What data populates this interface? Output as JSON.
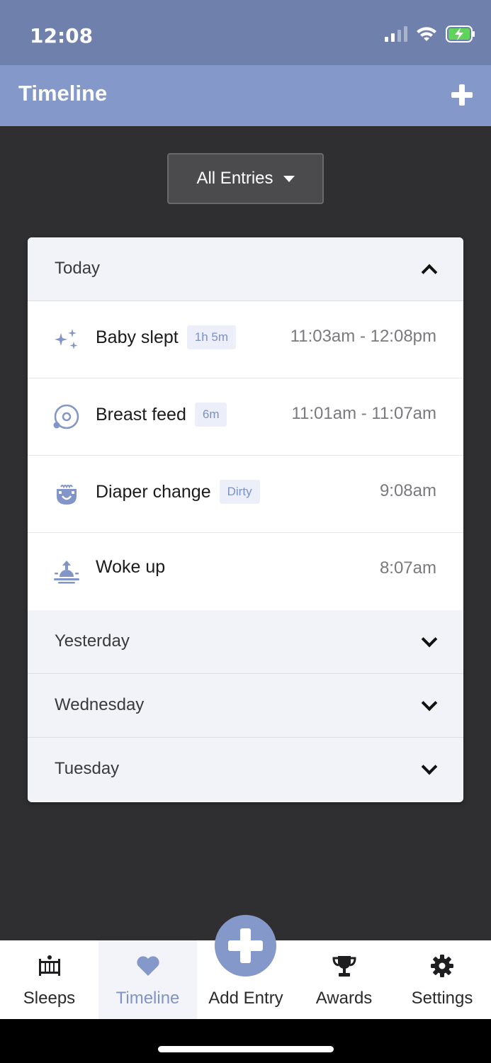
{
  "status": {
    "time": "12:08"
  },
  "header": {
    "title": "Timeline",
    "add_icon": "plus-icon"
  },
  "filter": {
    "label": "All Entries"
  },
  "sections": [
    {
      "label": "Today",
      "expanded": true
    },
    {
      "label": "Yesterday",
      "expanded": false
    },
    {
      "label": "Wednesday",
      "expanded": false
    },
    {
      "label": "Tuesday",
      "expanded": false
    }
  ],
  "entries": [
    {
      "icon": "sparkles-icon",
      "name": "Baby slept",
      "tag": "1h 5m",
      "time": "11:03am - 12:08pm"
    },
    {
      "icon": "breast-feed-icon",
      "name": "Breast feed",
      "tag": "6m",
      "time": "11:01am - 11:07am"
    },
    {
      "icon": "diaper-icon",
      "name": "Diaper change",
      "tag": "Dirty",
      "time": "9:08am"
    },
    {
      "icon": "sunrise-icon",
      "name": "Woke up",
      "tag": "",
      "time": "8:07am"
    }
  ],
  "tabs": [
    {
      "label": "Sleeps",
      "icon": "crib-icon"
    },
    {
      "label": "Timeline",
      "icon": "heart-icon",
      "active": true
    },
    {
      "label": "Add Entry",
      "icon": "plus-icon"
    },
    {
      "label": "Awards",
      "icon": "trophy-icon"
    },
    {
      "label": "Settings",
      "icon": "gear-icon"
    }
  ],
  "colors": {
    "accent": "#8498c9",
    "status_bar": "#6f80ad",
    "background": "#2f2f31",
    "tag_text": "#7b90c4"
  }
}
